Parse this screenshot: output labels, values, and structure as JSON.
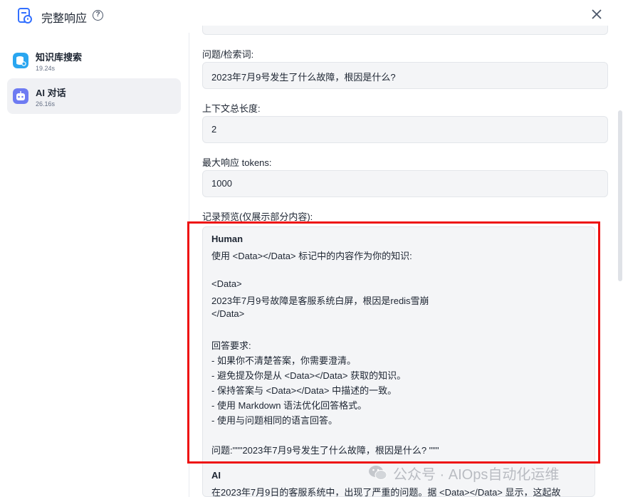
{
  "header": {
    "title": "完整响应",
    "help_glyph": "?"
  },
  "sidebar": {
    "items": [
      {
        "name": "知识库搜索",
        "time": "19.24s",
        "icon": "database-search-icon"
      },
      {
        "name": "AI 对话",
        "time": "26.16s",
        "icon": "robot-icon"
      }
    ]
  },
  "fields": {
    "query_label": "问题/检索词:",
    "query_value": "2023年7月9号发生了什么故障，根因是什么?",
    "context_label": "上下文总长度:",
    "context_value": "2",
    "tokens_label": "最大响应 tokens:",
    "tokens_value": "1000",
    "preview_label": "记录预览(仅展示部分内容):"
  },
  "preview": {
    "human_role": "Human",
    "lines": [
      "使用 <Data></Data> 标记中的内容作为你的知识:",
      "",
      "<Data>",
      "2023年7月9号故障是客服系统白屏，根因是redis雪崩",
      "</Data>",
      "",
      "回答要求:",
      "- 如果你不清楚答案，你需要澄清。",
      "- 避免提及你是从 <Data></Data> 获取的知识。",
      "- 保持答案与 <Data></Data> 中描述的一致。",
      "- 使用 Markdown 语法优化回答格式。",
      "- 使用与问题相同的语言回答。",
      "",
      "问题:\"\"\"2023年7月9号发生了什么故障，根因是什么? \"\"\""
    ],
    "ai_role": "AI",
    "ai_line": "在2023年7月9日的客服系统中，出现了严重的问题。据 <Data></Data> 显示，这起故"
  },
  "watermark": {
    "text": "公众号 · AIOps自动化运维"
  },
  "colors": {
    "highlight": "#ee1111",
    "accent": "#3370ff",
    "robot": "#6e7bf2"
  }
}
